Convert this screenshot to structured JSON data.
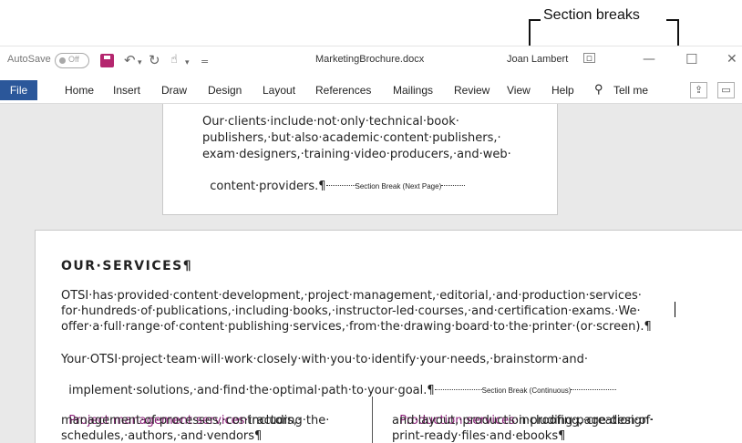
{
  "annotation": {
    "label": "Section breaks"
  },
  "titlebar": {
    "autosave_label": "AutoSave",
    "autosave_state": "Off",
    "filename": "MarketingBrochure.docx",
    "user": "Joan Lambert",
    "icons": [
      "save-icon",
      "undo-icon",
      "redo-icon",
      "touch-mode-icon",
      "customize-icon",
      "ribbon-display-icon",
      "minimize-icon",
      "maximize-icon",
      "close-icon"
    ]
  },
  "ribbon": {
    "tabs": [
      "File",
      "Home",
      "Insert",
      "Draw",
      "Design",
      "Layout",
      "References",
      "Mailings",
      "Review",
      "View",
      "Help"
    ],
    "tell_me": "Tell me",
    "file_tab_color": "#2b579a"
  },
  "document": {
    "top_page_lines": [
      "Our·clients·include·not·only·technical·book·",
      "publishers,·but·also·academic·content·publishers,·",
      "exam·designers,·training·video·producers,·and·web·",
      "content·providers.¶"
    ],
    "section_break_next_page": "Section Break (Next Page)",
    "heading": "OUR·SERVICES¶",
    "para1_lines": [
      "OTSI·has·provided·content·development,·project·management,·editorial,·and·production·services·",
      "for·hundreds·of·publications,·including·books,·instructor-led·courses,·and·certification·exams.·We·",
      "offer·a·full·range·of·content·publishing·services,·from·the·drawing·board·to·the·printer·(or·screen).¶"
    ],
    "para2_lines": [
      "Your·OTSI·project·team·will·work·closely·with·you·to·identify·your·needs,·brainstorm·and·",
      "implement·solutions,·and·find·the·optimal·path·to·your·goal.¶"
    ],
    "section_break_continuous": "Section Break (Continuous)",
    "col1": {
      "highlight": "Project·management·services·",
      "rest_first": "including·the·",
      "lines": [
        "management·of·processes,·contractors,·",
        "schedules,·authors,·and·vendors¶"
      ]
    },
    "col2": {
      "highlight": "Production·services·",
      "rest_first": "including·page·design·",
      "lines": [
        "and·layout,·production·proofing,·creation·of·",
        "print-ready·files·and·ebooks¶"
      ]
    },
    "accent_color": "#8a1f78"
  }
}
